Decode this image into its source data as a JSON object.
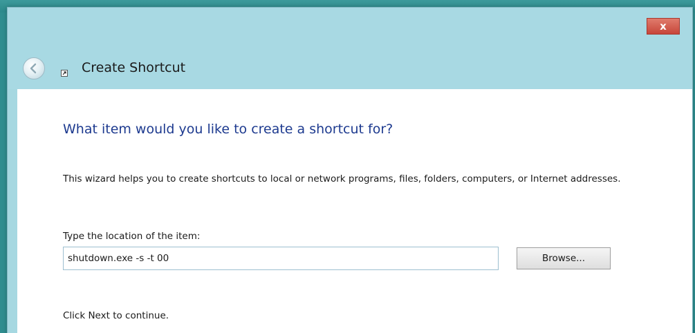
{
  "window": {
    "title": "Create Shortcut",
    "close_label": "x",
    "colors": {
      "frame": "#a8d9e3",
      "close": "#c7463a",
      "heading": "#1d3a8f"
    }
  },
  "wizard": {
    "heading": "What item would you like to create a shortcut for?",
    "description": "This wizard helps you to create shortcuts to local or network programs, files, folders, computers, or Internet addresses.",
    "location_label": "Type the location of the item:",
    "location_value": "shutdown.exe -s -t 00",
    "browse_label": "Browse...",
    "next_hint": "Click Next to continue."
  },
  "icons": {
    "back": "back-arrow-icon",
    "wizard": "shortcut-icon"
  }
}
